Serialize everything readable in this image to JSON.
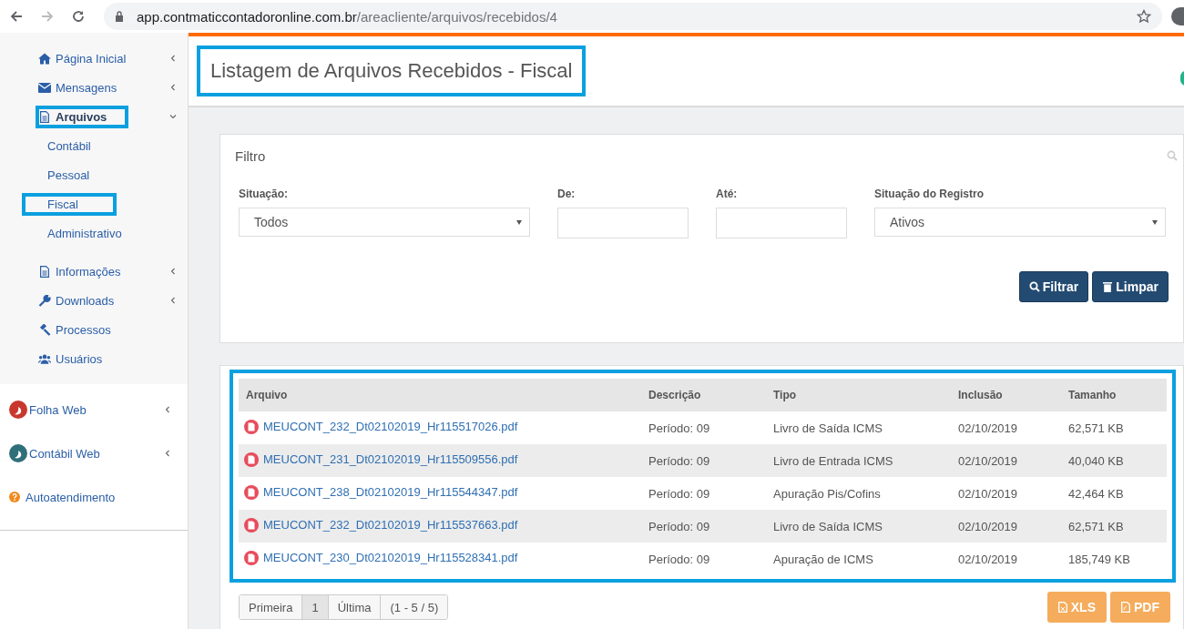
{
  "browser": {
    "url_host": "app.contmaticcontadoronline.com.br",
    "url_path": "/areacliente/arquivos/recebidos/4"
  },
  "sidebar": {
    "items": [
      {
        "label": "Página Inicial",
        "has_submenu": true,
        "expanded": false,
        "highlighted": false
      },
      {
        "label": "Mensagens",
        "has_submenu": true,
        "expanded": false,
        "highlighted": false
      },
      {
        "label": "Arquivos",
        "has_submenu": true,
        "expanded": true,
        "highlighted": true,
        "children": [
          {
            "label": "Contábil",
            "highlighted": false
          },
          {
            "label": "Pessoal",
            "highlighted": false
          },
          {
            "label": "Fiscal",
            "highlighted": true
          },
          {
            "label": "Administrativo",
            "highlighted": false
          }
        ]
      },
      {
        "label": "Informações",
        "has_submenu": true,
        "expanded": false,
        "highlighted": false
      },
      {
        "label": "Downloads",
        "has_submenu": true,
        "expanded": false,
        "highlighted": false
      },
      {
        "label": "Processos",
        "has_submenu": false,
        "expanded": false,
        "highlighted": false
      },
      {
        "label": "Usuários",
        "has_submenu": false,
        "expanded": false,
        "highlighted": false
      }
    ],
    "apps": [
      {
        "label": "Folha Web",
        "color": "#c8372d"
      },
      {
        "label": "Contábil Web",
        "color": "#2f6f7a"
      }
    ],
    "help": {
      "label": "Autoatendimento"
    }
  },
  "page": {
    "title": "Listagem de Arquivos Recebidos - Fiscal",
    "highlighted": true
  },
  "filter": {
    "title": "Filtro",
    "fields": [
      {
        "label": "Situação:",
        "kind": "select",
        "value": "Todos"
      },
      {
        "label": "De:",
        "kind": "input"
      },
      {
        "label": "Até:",
        "kind": "input"
      },
      {
        "label": "Situação do Registro",
        "kind": "select",
        "value": "Ativos"
      }
    ],
    "buttons": [
      "Filtrar",
      "Limpar"
    ]
  },
  "table": {
    "highlighted": true,
    "columns": [
      "Arquivo",
      "Descrição",
      "Tipo",
      "Inclusão",
      "Tamanho"
    ],
    "rows": [
      [
        "MEUCONT_232_Dt02102019_Hr115517026.pdf",
        "Período: 09",
        "Livro de Saída ICMS",
        "02/10/2019",
        "62,571 KB"
      ],
      [
        "MEUCONT_231_Dt02102019_Hr115509556.pdf",
        "Período: 09",
        "Livro de Entrada ICMS",
        "02/10/2019",
        "40,040 KB"
      ],
      [
        "MEUCONT_238_Dt02102019_Hr115544347.pdf",
        "Período: 09",
        "Apuração Pis/Cofins",
        "02/10/2019",
        "42,464 KB"
      ],
      [
        "MEUCONT_232_Dt02102019_Hr115537663.pdf",
        "Período: 09",
        "Livro de Saída ICMS",
        "02/10/2019",
        "62,571 KB"
      ],
      [
        "MEUCONT_230_Dt02102019_Hr115528341.pdf",
        "Período: 09",
        "Apuração de ICMS",
        "02/10/2019",
        "185,749 KB"
      ]
    ]
  },
  "pagination": [
    {
      "label": "Primeira",
      "selected": false
    },
    {
      "label": "1",
      "selected": true
    },
    {
      "label": "Última",
      "selected": false
    },
    {
      "label": "(1 - 5 / 5)",
      "selected": false
    }
  ],
  "exports": [
    "XLS",
    "PDF"
  ]
}
